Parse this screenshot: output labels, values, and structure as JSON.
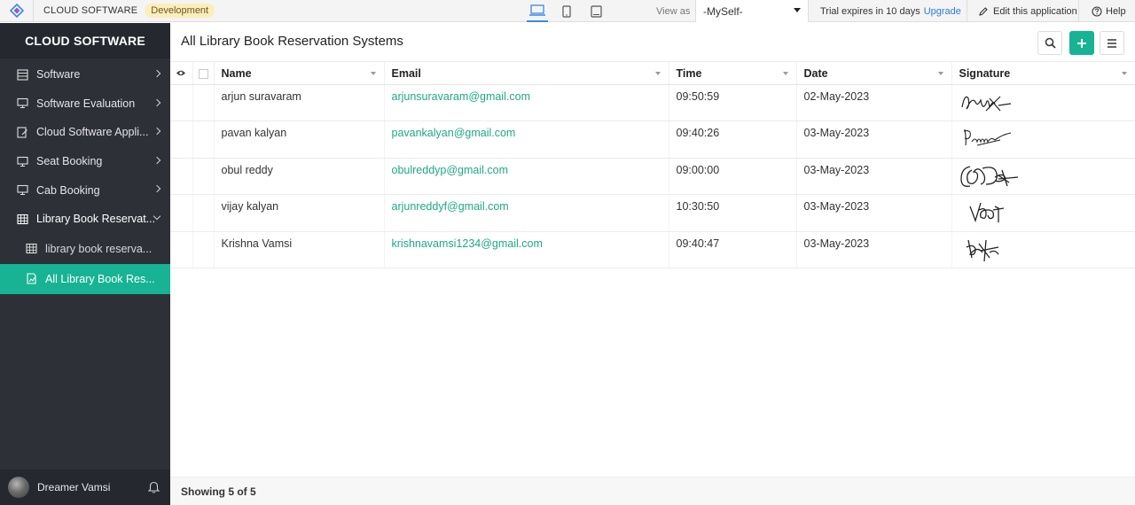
{
  "topbar": {
    "app_name": "CLOUD SOFTWARE",
    "env_badge": "Development",
    "view_as_label": "View as",
    "view_as_value": "-MySelf-",
    "trial_text": "Trial expires in 10 days",
    "upgrade_label": "Upgrade",
    "edit_label": "Edit this application",
    "help_label": "Help"
  },
  "sidebar": {
    "title": "CLOUD SOFTWARE",
    "items": [
      {
        "label": "Software"
      },
      {
        "label": "Software Evaluation"
      },
      {
        "label": "Cloud Software Appli..."
      },
      {
        "label": "Seat Booking"
      },
      {
        "label": "Cab Booking"
      },
      {
        "label": "Library Book Reservat..."
      },
      {
        "label": "library book reserva..."
      },
      {
        "label": "All Library Book Res..."
      }
    ],
    "user": "Dreamer Vamsi"
  },
  "main": {
    "title": "All Library Book Reservation Systems",
    "columns": [
      "Name",
      "Email",
      "Time",
      "Date",
      "Signature"
    ],
    "rows": [
      {
        "name": "arjun suravaram",
        "email": "arjunsuravaram@gmail.com",
        "time": "09:50:59",
        "date": "02-May-2023"
      },
      {
        "name": "pavan kalyan",
        "email": "pavankalyan@gmail.com",
        "time": "09:40:26",
        "date": "03-May-2023"
      },
      {
        "name": "obul reddy",
        "email": "obulreddyp@gmail.com",
        "time": "09:00:00",
        "date": "03-May-2023"
      },
      {
        "name": "vijay kalyan",
        "email": "arjunreddyf@gmail.com",
        "time": "10:30:50",
        "date": "03-May-2023"
      },
      {
        "name": "Krishna Vamsi",
        "email": "krishnavamsi1234@gmail.com",
        "time": "09:40:47",
        "date": "03-May-2023"
      }
    ],
    "footer": "Showing 5 of 5"
  },
  "colors": {
    "accent": "#17b394",
    "sidebar_bg": "#2e3038",
    "badge_bg": "#fcedbc",
    "link": "#2e79d6"
  }
}
